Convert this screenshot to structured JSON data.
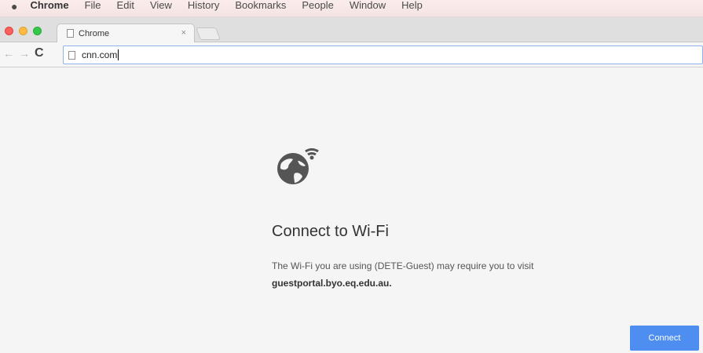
{
  "menubar": {
    "app_name": "Chrome",
    "items": [
      "File",
      "Edit",
      "View",
      "History",
      "Bookmarks",
      "People",
      "Window",
      "Help"
    ]
  },
  "tab": {
    "title": "Chrome",
    "close_glyph": "×"
  },
  "toolbar": {
    "back_glyph": "←",
    "forward_glyph": "→",
    "reload_glyph": "C",
    "url": "cnn.com"
  },
  "content": {
    "icon": "globe-wifi-icon",
    "heading": "Connect to Wi-Fi",
    "description": "The Wi-Fi you are using (DETE-Guest) may require you to visit",
    "host": "guestportal.byo.eq.edu.au.",
    "button_label": "Connect",
    "accent_color": "#4d8ef0"
  }
}
